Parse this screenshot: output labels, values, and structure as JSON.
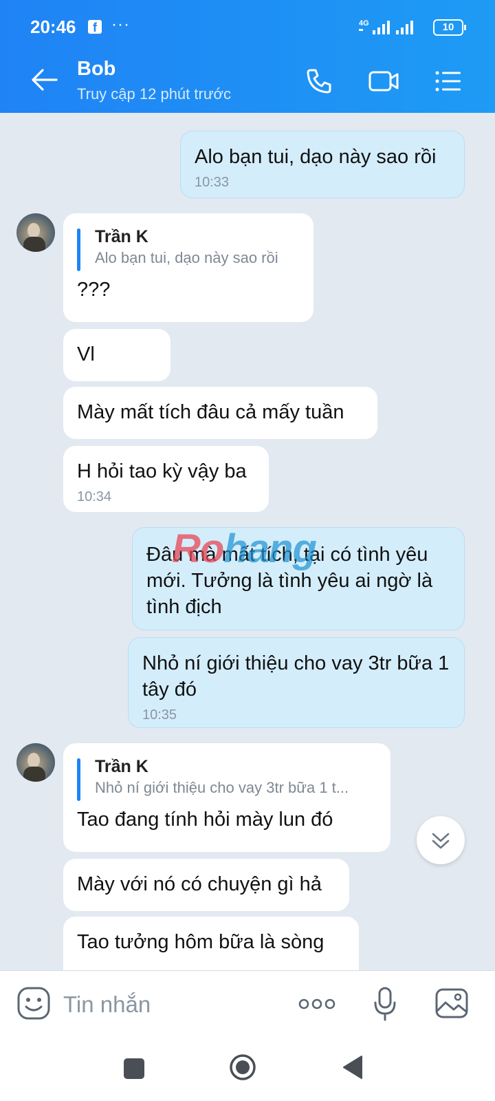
{
  "status_bar": {
    "time": "20:46",
    "network": "4G",
    "battery": "10"
  },
  "header": {
    "contact_name": "Bob",
    "last_seen": "Truy cập 12 phút trước"
  },
  "messages": [
    {
      "text": "Alo bạn tui, dạo này sao rồi",
      "time": "10:33"
    },
    {
      "quote_author": "Trần K",
      "quote_text": "Alo bạn tui, dạo này sao rồi",
      "text": "???"
    },
    {
      "text": "Vl"
    },
    {
      "text": "Mày mất tích đâu cả mấy tuần"
    },
    {
      "text": "H hỏi tao kỳ vậy ba",
      "time": "10:34"
    },
    {
      "text": "Đâu mà mất tích, tại có tình yêu mới. Tưởng là tình yêu ai ngờ là tình địch"
    },
    {
      "text": "Nhỏ ní giới thiệu cho vay 3tr bữa 1 tây đó",
      "time": "10:35"
    },
    {
      "quote_author": "Trần K",
      "quote_text": "Nhỏ ní giới thiệu cho vay 3tr bữa 1 t...",
      "text": "Tao đang tính hỏi mày lun đó"
    },
    {
      "text": "Mày với nó có chuyện gì hả"
    },
    {
      "text": "Tao tưởng hôm bữa là sòng"
    }
  ],
  "watermark": {
    "part1": "Ro",
    "part2": "hang"
  },
  "input": {
    "placeholder": "Tin nhắn"
  },
  "colors": {
    "header": "#1F83F5",
    "accent": "#1F83F5",
    "mine_bubble": "#D4EDFB",
    "background": "#E2E9F1"
  }
}
